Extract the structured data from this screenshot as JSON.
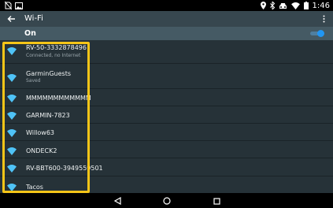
{
  "status_bar": {
    "time": "1:46"
  },
  "app_bar": {
    "title": "Wi-Fi"
  },
  "toggle": {
    "label": "On",
    "state": "on"
  },
  "networks": [
    {
      "name": "RV-50-3332878496",
      "status": "Connected, no Internet"
    },
    {
      "name": "GarminGuests",
      "status": "Saved"
    },
    {
      "name": "MMMMMMMMMMMM",
      "status": ""
    },
    {
      "name": "GARMIN-7823",
      "status": ""
    },
    {
      "name": "Willow63",
      "status": ""
    },
    {
      "name": "ONDECK2",
      "status": ""
    },
    {
      "name": "RV-BBT600-3949559501",
      "status": ""
    },
    {
      "name": "Tacos",
      "status": ""
    }
  ],
  "colors": {
    "app_bar": "#37474f",
    "toggle_bar": "#455a64",
    "list_background": "#263238",
    "wifi_icon": "#4fc3f7",
    "switch_accent": "#2196f3",
    "highlight": "#f5c518"
  }
}
